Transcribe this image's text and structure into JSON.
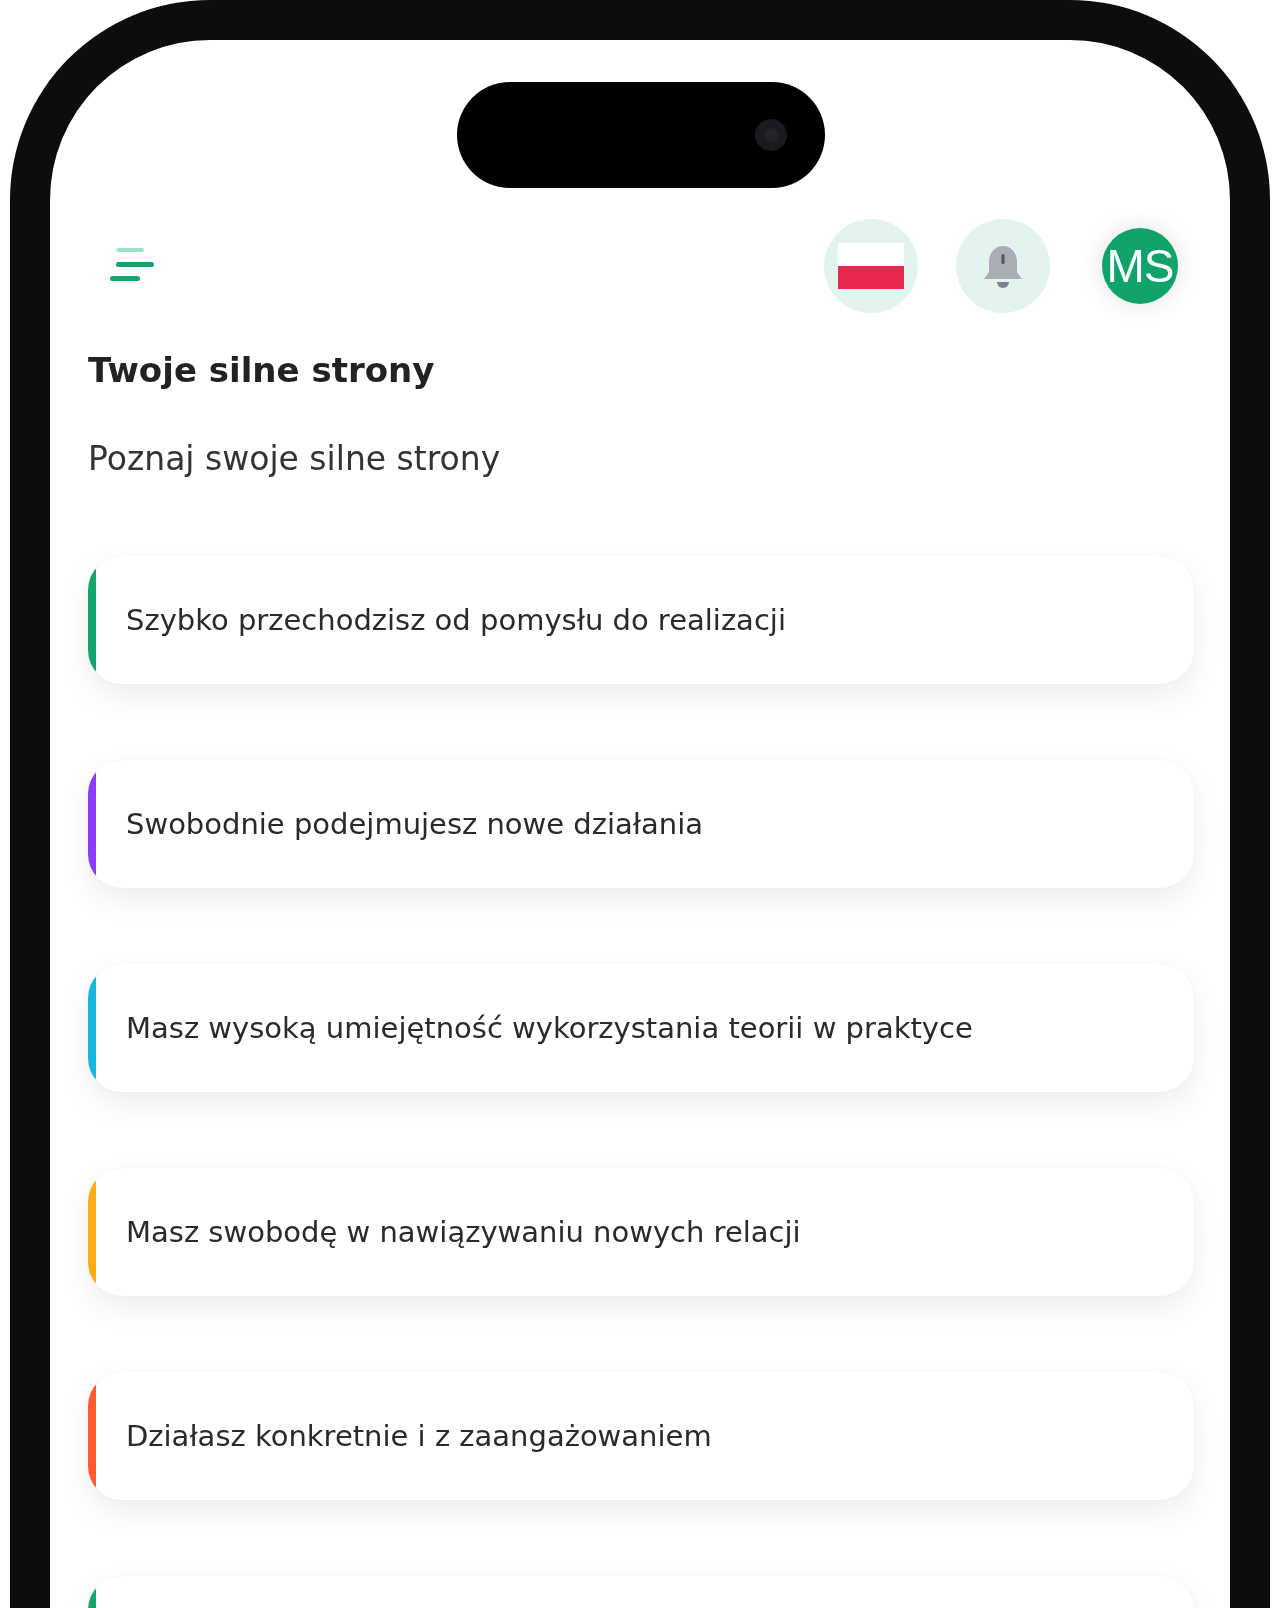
{
  "header": {
    "avatar_initials": "MS"
  },
  "title": "Twoje silne strony",
  "subtitle": "Poznaj swoje silne strony",
  "strengths": [
    {
      "text": "Szybko przechodzisz od pomysłu do realizacji",
      "color": "#14a46c"
    },
    {
      "text": "Swobodnie podejmujesz nowe działania",
      "color": "#8c3cf5"
    },
    {
      "text": "Masz wysoką umiejętność wykorzystania teorii w praktyce",
      "color": "#19b6dc"
    },
    {
      "text": "Masz swobodę w nawiązywaniu nowych relacji",
      "color": "#ffac14"
    },
    {
      "text": "Działasz konkretnie i z zaangażowaniem",
      "color": "#ff5a32"
    },
    {
      "color": "#14a46c"
    }
  ]
}
